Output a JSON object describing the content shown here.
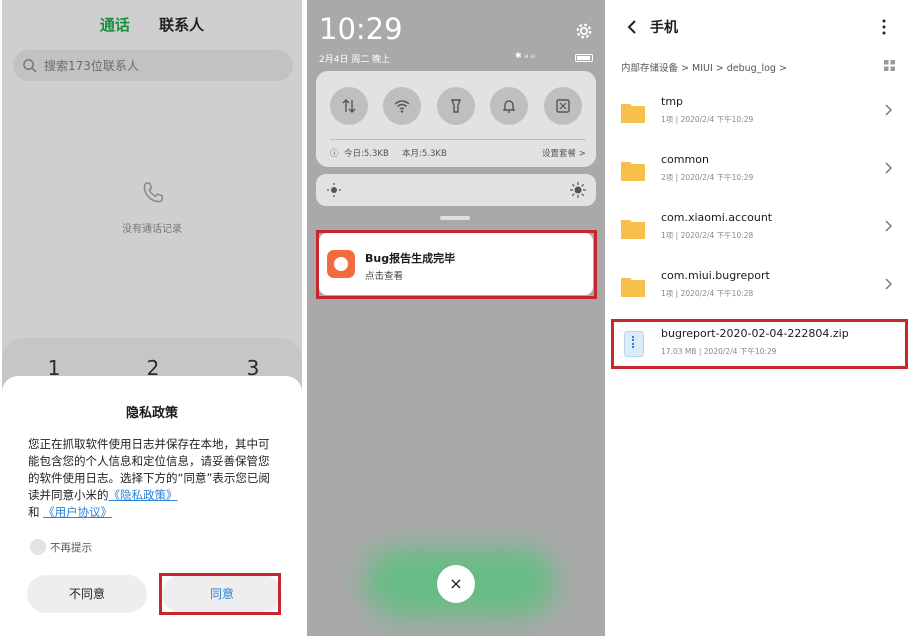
{
  "panel1": {
    "tabs": {
      "active": "通话",
      "other": "联系人"
    },
    "search_placeholder": "搜索173位联系人",
    "empty_text": "没有通话记录",
    "keypad_digits": [
      "1",
      "2",
      "3"
    ],
    "dialog": {
      "title": "隐私政策",
      "body_text": "您正在抓取软件使用日志并保存在本地，其中可能包含您的个人信息和定位信息，请妥善保管您的软件使用日志。选择下方的“同意”表示您已阅读并同意小米的",
      "privacy_link": "《隐私政策》",
      "and_text": "和",
      "agreement_link": "《用户协议》",
      "checkbox_label": "不再提示",
      "disagree_label": "不同意",
      "agree_label": "同意"
    }
  },
  "panel2": {
    "time": "10:29",
    "date": "2月4日 周二 晚上",
    "status_text": "✱ ᵢₗₗ ᵢₗₗ",
    "quick_toggles": [
      "data-toggle-icon",
      "wifi-icon",
      "flashlight-icon",
      "bell-icon",
      "screenshot-icon"
    ],
    "data_today": "今日:5.3KB",
    "data_month": "本月:5.3KB",
    "data_settings": "设置套餐 >",
    "notification": {
      "title": "Bug报告生成完毕",
      "subtitle": "点击查看",
      "icon_color": "#f26a3d"
    },
    "close_label": "×"
  },
  "panel3": {
    "title": "手机",
    "breadcrumb": "内部存储设备 > MIUI > debug_log >",
    "items": [
      {
        "name": "tmp",
        "meta": "1项 | 2020/2/4 下午10:29"
      },
      {
        "name": "common",
        "meta": "2项 | 2020/2/4 下午10:29"
      },
      {
        "name": "com.xiaomi.account",
        "meta": "1项 | 2020/2/4 下午10:28"
      },
      {
        "name": "com.miui.bugreport",
        "meta": "1项 | 2020/2/4 下午10:28"
      }
    ],
    "zip_file": {
      "name": "bugreport-2020-02-04-222804.zip",
      "meta": "17.03 MB | 2020/2/4 下午10:29"
    }
  },
  "colors": {
    "accent_green": "#1a8f3c",
    "link_blue": "#2a82d6",
    "highlight_red": "#c6262e",
    "folder_yellow": "#f7c04a"
  }
}
